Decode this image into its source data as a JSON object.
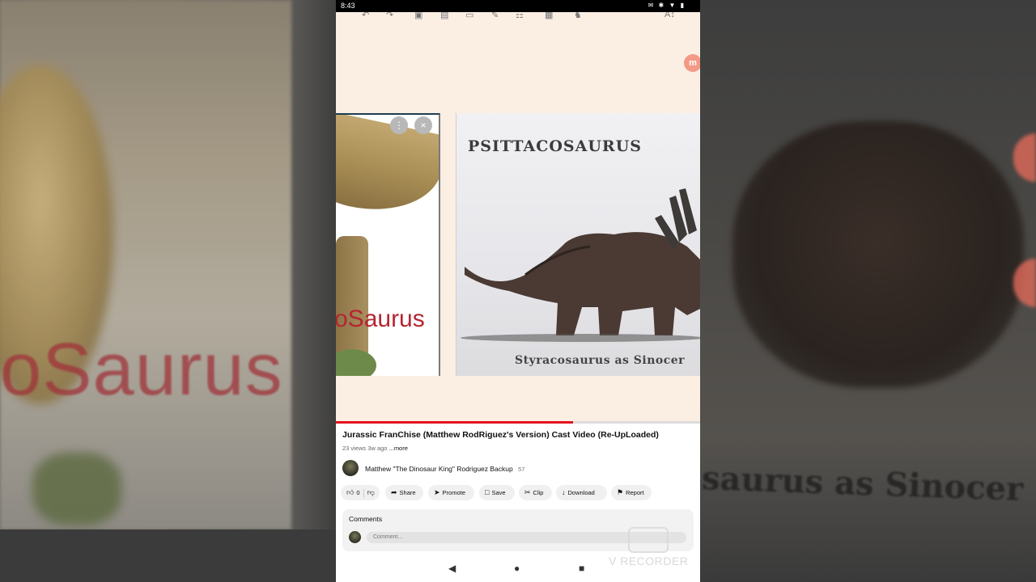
{
  "status_bar": {
    "time": "8:43",
    "icons": "✉ ✱ ▼ ▮"
  },
  "video": {
    "toolbar_icons": [
      "undo-icon",
      "redo-icon",
      "scan-icon",
      "image-icon",
      "shape-icon",
      "pen-icon",
      "columns-icon",
      "table-icon",
      "stamp-icon",
      "text-size-icon"
    ],
    "fab_label": "m",
    "left_card": {
      "label": "oSaurus",
      "menu_icon": "⋮",
      "close_icon": "×"
    },
    "right_card": {
      "title": "PSITTACOSAURUS",
      "caption": "Styracosaurus as Sinocer"
    },
    "progress": 0.65
  },
  "info": {
    "title": "Jurassic FranChise (Matthew RodRiguez's Version) Cast Video (Re-UpLoaded)",
    "views": "23 views",
    "age": "3w ago",
    "more": "...more",
    "channel_name": "Matthew \"The Dinosaur King\" Rodriguez Backup",
    "subscribers": "57",
    "actions": {
      "like_count": "0",
      "share": "Share",
      "promote": "Promote",
      "save": "Save",
      "clip": "Clip",
      "download": "Download",
      "report": "Report"
    },
    "comments": {
      "header": "Comments",
      "placeholder": "Comment..."
    }
  },
  "background": {
    "left_text": "oSaurus",
    "right_text": "saurus as Sinocer"
  },
  "nav": {
    "back": "◀",
    "home": "●",
    "recents": "■"
  },
  "watermark": {
    "text": "V RECORDER"
  },
  "colors": {
    "progress": "#e2131e",
    "video_bg": "#fbeee3",
    "label_red": "#b52532"
  }
}
